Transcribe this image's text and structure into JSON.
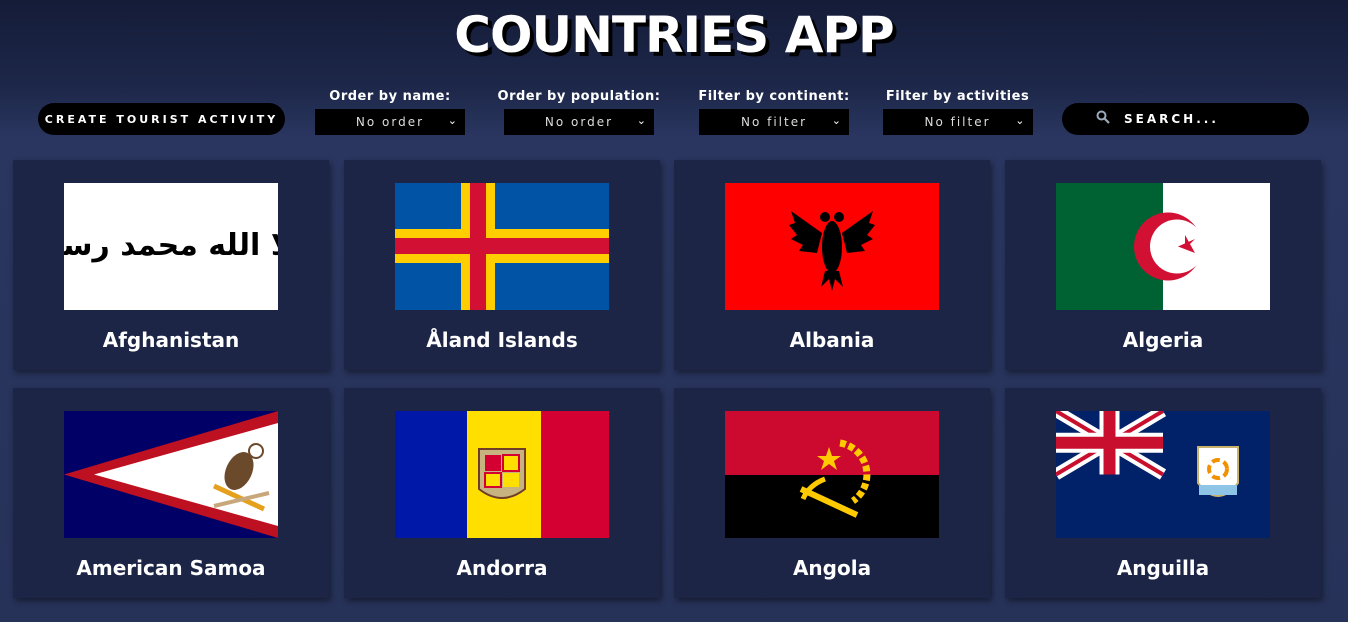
{
  "app": {
    "title": "COUNTRIES APP"
  },
  "toolbar": {
    "create_label": "CREATE TOURIST ACTIVITY",
    "search_placeholder": "SEARCH...",
    "filters": [
      {
        "label": "Order by name:",
        "value": "No order"
      },
      {
        "label": "Order by population:",
        "value": "No order"
      },
      {
        "label": "Filter by continent:",
        "value": "No filter"
      },
      {
        "label": "Filter by activities",
        "value": "No filter"
      }
    ]
  },
  "countries": [
    {
      "name": "Afghanistan",
      "flag_script": "لا إله إلا الله محمد رسول الله"
    },
    {
      "name": "Åland Islands"
    },
    {
      "name": "Albania"
    },
    {
      "name": "Algeria"
    },
    {
      "name": "American Samoa"
    },
    {
      "name": "Andorra"
    },
    {
      "name": "Angola"
    },
    {
      "name": "Anguilla"
    }
  ],
  "colors": {
    "card_bg": "#1c2546",
    "control_bg": "#000000"
  }
}
